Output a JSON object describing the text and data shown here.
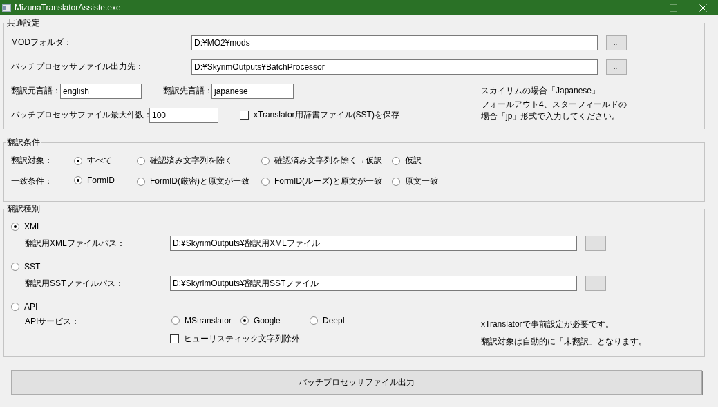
{
  "window": {
    "title": "MizunaTranslatorAssiste.exe"
  },
  "common_settings": {
    "title": "共通設定",
    "paths": [
      {
        "label": "MODフォルダ：",
        "value": "D:¥MO2¥mods",
        "browse": "..."
      },
      {
        "label": "バッチプロセッサファイル出力先：",
        "value": "D:¥SkyrimOutputs¥BatchProcessor",
        "browse": "..."
      }
    ],
    "source_language": {
      "label": "翻訳元言語：",
      "value": "english"
    },
    "target_language": {
      "label": "翻訳先言語：",
      "value": "japanese"
    },
    "max_files": {
      "label": "バッチプロセッサファイル最大件数：",
      "value": "100"
    },
    "save_sst": {
      "label": "xTranslator用辞書ファイル(SST)を保存",
      "checked": false
    },
    "note_lines": [
      "スカイリムの場合「Japanese」",
      "フォールアウト4、スターフィールドの",
      "場合「jp」形式で入力してください。"
    ]
  },
  "translation_conditions": {
    "title": "翻訳条件",
    "rows": [
      {
        "label": "翻訳対象：",
        "options": [
          {
            "label": "すべて",
            "selected": true
          },
          {
            "label": "確認済み文字列を除く",
            "selected": false
          },
          {
            "label": "確認済み文字列を除く→仮訳",
            "selected": false
          },
          {
            "label": "仮訳",
            "selected": false
          }
        ]
      },
      {
        "label": "一致条件：",
        "options": [
          {
            "label": "FormID",
            "selected": true
          },
          {
            "label": "FormID(厳密)と原文が一致",
            "selected": false
          },
          {
            "label": "FormID(ルーズ)と原文が一致",
            "selected": false
          },
          {
            "label": "原文一致",
            "selected": false
          }
        ]
      }
    ]
  },
  "translation_type": {
    "title": "翻訳種別",
    "types": [
      {
        "kind": "file",
        "label": "XML",
        "selected": true,
        "path_label": "翻訳用XMLファイルパス：",
        "path": "D:¥SkyrimOutputs¥翻訳用XMLファイル",
        "browse": "..."
      },
      {
        "kind": "file",
        "label": "SST",
        "selected": false,
        "path_label": "翻訳用SSTファイルパス：",
        "path": "D:¥SkyrimOutputs¥翻訳用SSTファイル",
        "browse": "..."
      },
      {
        "kind": "api",
        "label": "API",
        "selected": false,
        "service_label": "APIサービス：",
        "services": [
          {
            "label": "MStranslator",
            "selected": false
          },
          {
            "label": "Google",
            "selected": true
          },
          {
            "label": "DeepL",
            "selected": false
          }
        ],
        "heuristic": {
          "label": "ヒューリスティック文字列除外",
          "checked": false
        },
        "note_lines": [
          "xTranslatorで事前設定が必要です。",
          "翻訳対象は自動的に「未翻訳」となります。"
        ]
      }
    ]
  },
  "output_button": "バッチプロセッサファイル出力"
}
